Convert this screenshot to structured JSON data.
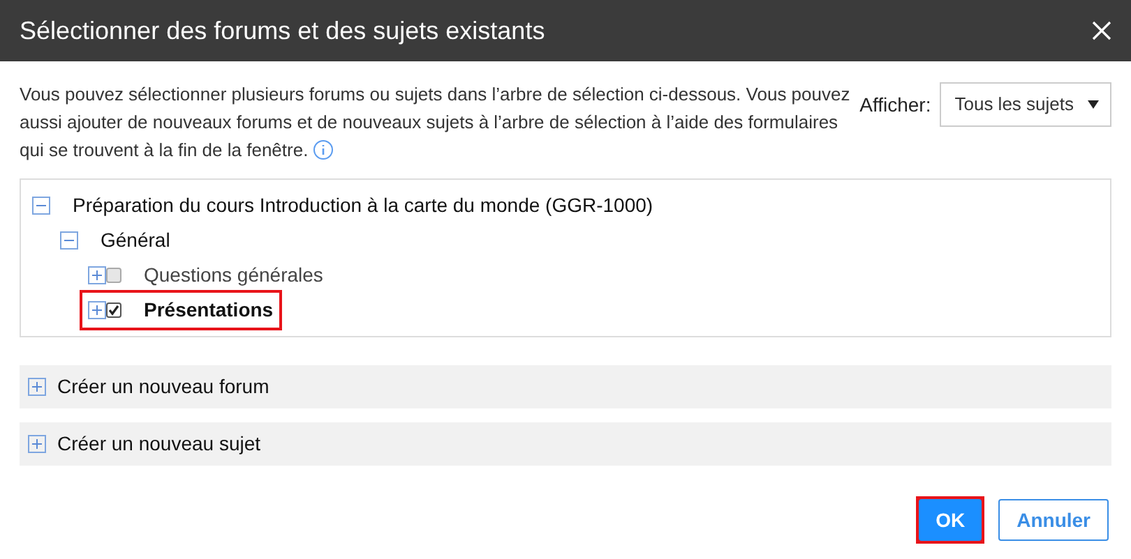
{
  "window": {
    "title": "Sélectionner des forums et des sujets existants"
  },
  "intro": "Vous pouvez sélectionner plusieurs forums ou sujets dans l’arbre de sélection ci-dessous. Vous pouvez aussi ajouter de nouveaux forums et de nouveaux sujets à l’arbre de sélection à l’aide des formulaires qui se trouvent à la fin de la fenêtre.",
  "filter": {
    "label": "Afficher:",
    "value": "Tous les sujets"
  },
  "tree": [
    {
      "label": "Préparation du cours Introduction à la carte du monde (GGR-1000)",
      "expanded": true,
      "children": [
        {
          "label": "Général",
          "expanded": true,
          "children": [
            {
              "label": "Questions générales",
              "expanded": false,
              "checked": false,
              "highlighted": false
            },
            {
              "label": "Présentations",
              "expanded": false,
              "checked": true,
              "highlighted": true
            }
          ]
        }
      ]
    }
  ],
  "sections": [
    {
      "label": "Créer un nouveau forum",
      "expanded": false
    },
    {
      "label": "Créer un nouveau sujet",
      "expanded": false
    }
  ],
  "buttons": [
    {
      "label": "OK",
      "kind": "primary",
      "highlighted": true
    },
    {
      "label": "Annuler",
      "kind": "secondary",
      "highlighted": false
    }
  ]
}
